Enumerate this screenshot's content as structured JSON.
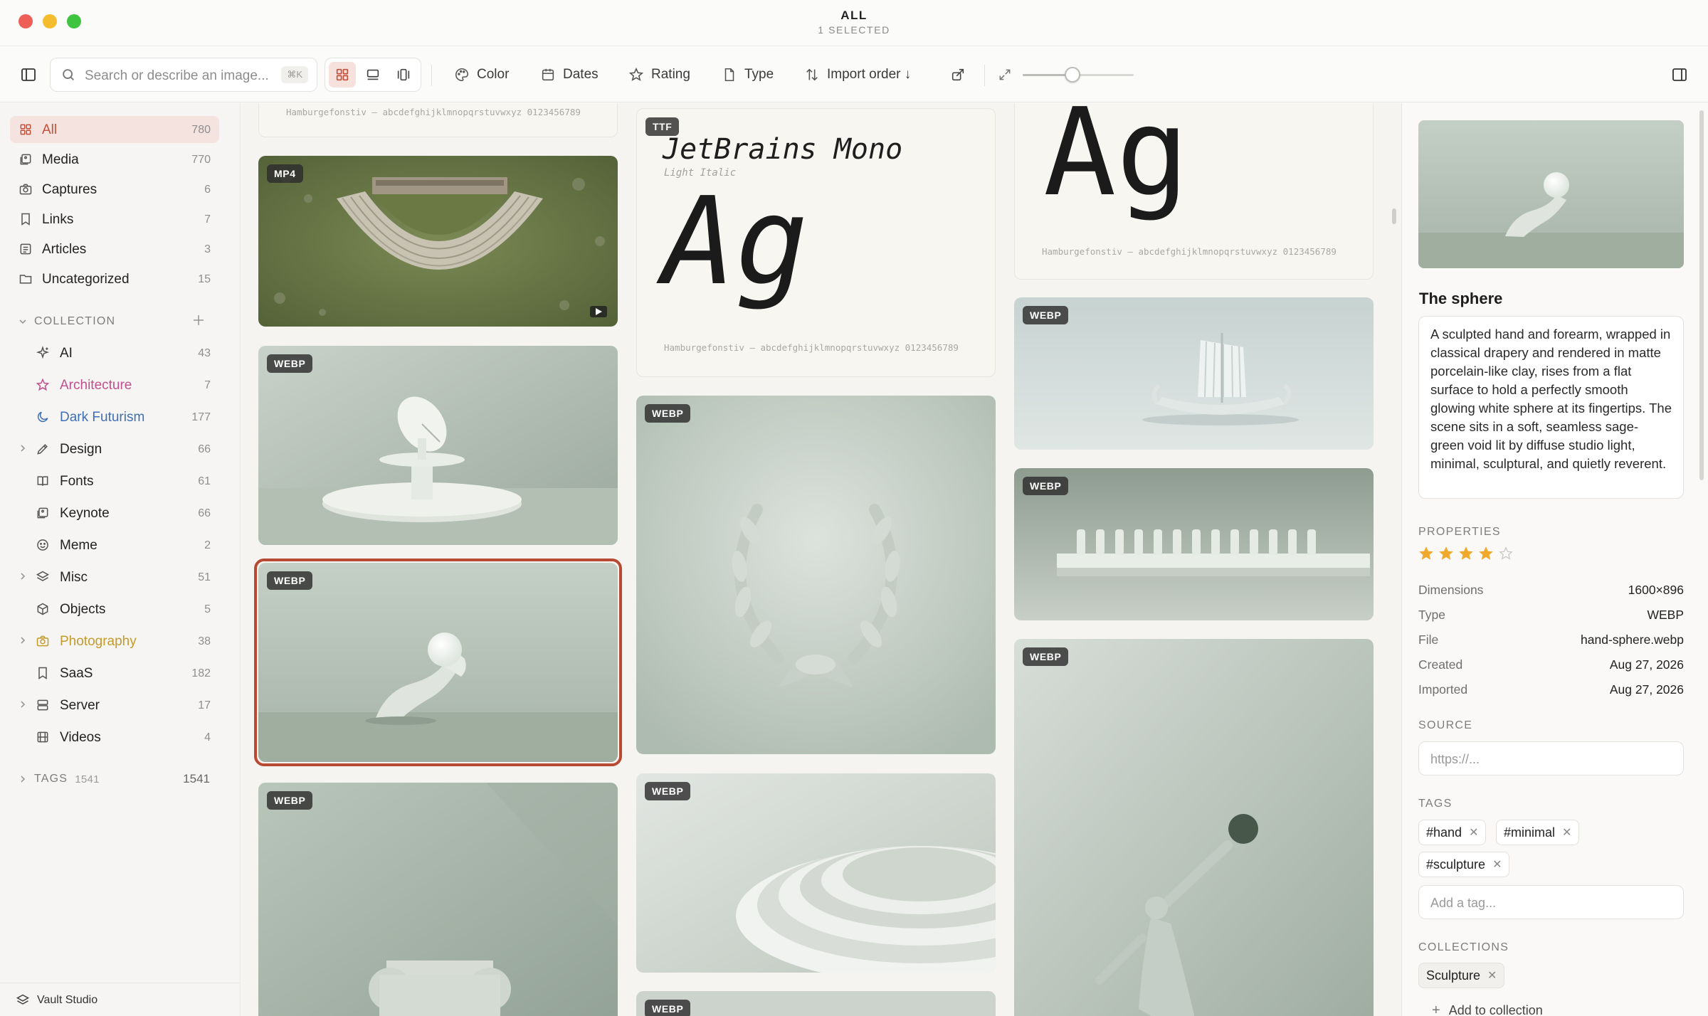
{
  "window": {
    "title": "ALL",
    "subtitle": "1 SELECTED"
  },
  "toolbar": {
    "search_placeholder": "Search or describe an image...",
    "search_shortcut": "⌘K",
    "color_label": "Color",
    "dates_label": "Dates",
    "rating_label": "Rating",
    "type_label": "Type",
    "sort_label": "Import order ↓",
    "zoom_level": 0.45
  },
  "sidebar": {
    "library": [
      {
        "label": "All",
        "count": "780",
        "icon": "grid-icon",
        "active": true
      },
      {
        "label": "Media",
        "count": "770",
        "icon": "images-icon"
      },
      {
        "label": "Captures",
        "count": "6",
        "icon": "camera-icon"
      },
      {
        "label": "Links",
        "count": "7",
        "icon": "bookmark-icon"
      },
      {
        "label": "Articles",
        "count": "3",
        "icon": "newspaper-icon"
      },
      {
        "label": "Uncategorized",
        "count": "15",
        "icon": "folder-icon"
      }
    ],
    "collection_header": "COLLECTION",
    "collections": [
      {
        "label": "AI",
        "count": "43",
        "color": "#222222",
        "icon": "sparkles-icon"
      },
      {
        "label": "Architecture",
        "count": "7",
        "color": "#c0508e",
        "icon": "star-icon"
      },
      {
        "label": "Dark Futurism",
        "count": "177",
        "color": "#3f6fb5",
        "icon": "moon-icon"
      },
      {
        "label": "Design",
        "count": "66",
        "color": "#222222",
        "icon": "pen-icon",
        "expandable": true
      },
      {
        "label": "Fonts",
        "count": "61",
        "color": "#222222",
        "icon": "book-icon"
      },
      {
        "label": "Keynote",
        "count": "66",
        "color": "#222222",
        "icon": "images-icon"
      },
      {
        "label": "Meme",
        "count": "2",
        "color": "#222222",
        "icon": "smile-icon"
      },
      {
        "label": "Misc",
        "count": "51",
        "color": "#222222",
        "icon": "layers-icon",
        "expandable": true
      },
      {
        "label": "Objects",
        "count": "5",
        "color": "#222222",
        "icon": "box-icon"
      },
      {
        "label": "Photography",
        "count": "38",
        "color": "#c49a2a",
        "icon": "camera-icon",
        "expandable": true
      },
      {
        "label": "SaaS",
        "count": "182",
        "color": "#222222",
        "icon": "bookmark-icon"
      },
      {
        "label": "Server",
        "count": "17",
        "color": "#222222",
        "icon": "server-icon",
        "expandable": true
      },
      {
        "label": "Videos",
        "count": "4",
        "color": "#222222",
        "icon": "film-icon"
      }
    ],
    "tags_header": "TAGS",
    "tags_count_small": "1541",
    "tags_count": "1541",
    "workspace": "Vault Studio"
  },
  "gallery": {
    "font_specimen": "Hamburgefonstiv — abcdefghijklmnopqrstuvwxyz 0123456789",
    "font_name": "JetBrains Mono",
    "font_style": "Light Italic",
    "glyphs": "Ag",
    "badges": {
      "mp4": "MP4",
      "ttf": "TTF",
      "webp": "WEBP"
    }
  },
  "inspector": {
    "title": "The sphere",
    "description": "A sculpted hand and forearm, wrapped in classical drapery and rendered in matte porcelain-like clay, rises from a flat surface to hold a perfectly smooth glowing white sphere at its fingertips. The scene sits in a soft, seamless sage-green void lit by diffuse studio light, minimal, sculptural, and quietly reverent.",
    "properties_header": "PROPERTIES",
    "rating": 4,
    "rating_max": 5,
    "properties": [
      {
        "key": "Dimensions",
        "value": "1600×896"
      },
      {
        "key": "Type",
        "value": "WEBP"
      },
      {
        "key": "File",
        "value": "hand-sphere.webp"
      },
      {
        "key": "Created",
        "value": "Aug 27, 2026"
      },
      {
        "key": "Imported",
        "value": "Aug 27, 2026"
      }
    ],
    "source_header": "SOURCE",
    "source_placeholder": "https://...",
    "tags_header": "TAGS",
    "tags": [
      "#hand",
      "#minimal",
      "#sculpture"
    ],
    "tag_placeholder": "Add a tag...",
    "collections_header": "COLLECTIONS",
    "collections": [
      "Sculpture"
    ],
    "add_collection": "Add to collection"
  },
  "colors": {
    "accent": "#c2503a",
    "selection": "#b84a34",
    "star": "#f0a92c"
  }
}
